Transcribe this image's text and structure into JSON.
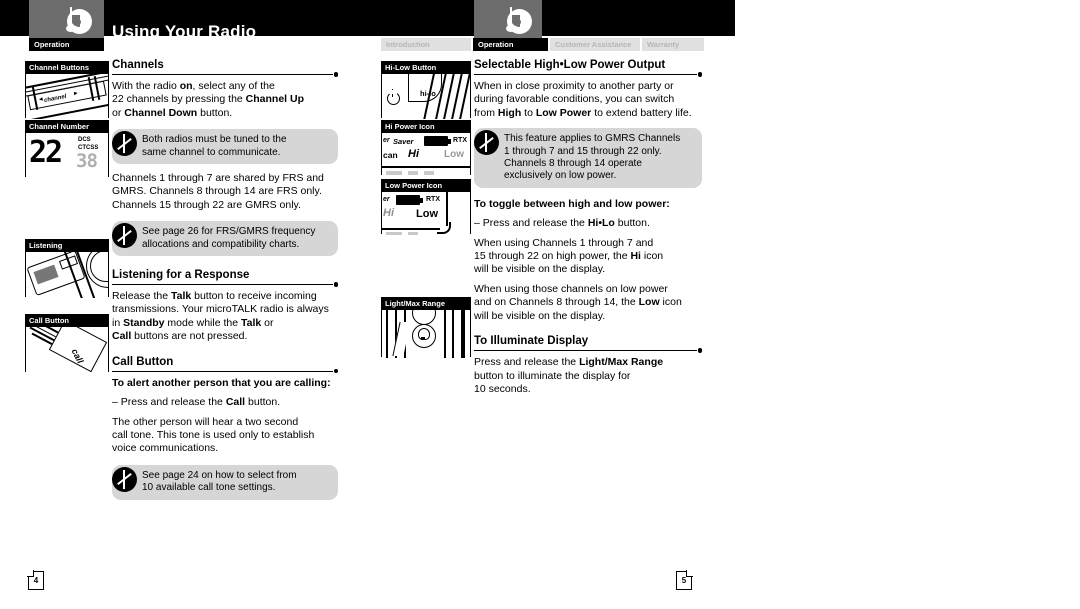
{
  "document": {
    "header_title": "Using Your Radio",
    "logo_name": "cobra-logo"
  },
  "tabs_left": [
    {
      "label": "Operation",
      "active": true
    }
  ],
  "tabs_right": [
    {
      "label": "Introduction",
      "active": false
    },
    {
      "label": "Operation",
      "active": true
    },
    {
      "label": "Customer Assistance",
      "active": false
    },
    {
      "label": "Warranty",
      "active": false
    }
  ],
  "left_page": {
    "page_number": "4",
    "figures": [
      {
        "caption": "Channel Buttons",
        "lcd": {
          "label": "channel",
          "left_arrow": "◄",
          "right_arrow": "►"
        }
      },
      {
        "caption": "Channel Number",
        "lcd": {
          "channel": "22",
          "sub": "38",
          "dcs": "DCS",
          "ctcss": "CTCSS"
        }
      },
      {
        "caption": "Listening"
      },
      {
        "caption": "Call Button",
        "lcd": {
          "label": "call"
        }
      }
    ],
    "sections": [
      {
        "heading": "Channels",
        "blocks": [
          {
            "type": "para",
            "runs": [
              {
                "t": "With the radio ",
                "b": false
              },
              {
                "t": "on",
                "b": true
              },
              {
                "t": ", select any of the\n22 channels by pressing the ",
                "b": false
              },
              {
                "t": "Channel Up",
                "b": true
              },
              {
                "t": "\nor ",
                "b": false
              },
              {
                "t": "Channel Down",
                "b": true
              },
              {
                "t": " button.",
                "b": false
              }
            ]
          },
          {
            "type": "callout",
            "text": "Both radios must be tuned to the\nsame channel to communicate."
          },
          {
            "type": "para",
            "runs": [
              {
                "t": "Channels 1 through 7 are shared by FRS and\nGMRS. Channels 8 through 14 are FRS only.\nChannels 15 through 22 are GMRS only.",
                "b": false
              }
            ]
          },
          {
            "type": "callout",
            "text": "See page 26 for FRS/GMRS frequency\nallocations and compatibility charts."
          }
        ]
      },
      {
        "heading": "Listening for a Response",
        "blocks": [
          {
            "type": "para",
            "runs": [
              {
                "t": "Release the ",
                "b": false
              },
              {
                "t": "Talk",
                "b": true
              },
              {
                "t": " button to receive incoming\ntransmissions. Your microTALK radio is always\nin ",
                "b": false
              },
              {
                "t": "Standby",
                "b": true
              },
              {
                "t": " mode while the ",
                "b": false
              },
              {
                "t": "Talk",
                "b": true
              },
              {
                "t": " or\n",
                "b": false
              },
              {
                "t": "Call",
                "b": true
              },
              {
                "t": " buttons are not pressed.",
                "b": false
              }
            ]
          }
        ]
      },
      {
        "heading": "Call Button",
        "blocks": [
          {
            "type": "subhead",
            "text": "To alert another person that you are calling:"
          },
          {
            "type": "para",
            "runs": [
              {
                "t": "– Press and release the ",
                "b": false
              },
              {
                "t": "Call",
                "b": true
              },
              {
                "t": " button.",
                "b": false
              }
            ]
          },
          {
            "type": "para",
            "runs": [
              {
                "t": "The other person will hear a two second\ncall tone. This tone is used only to establish\nvoice communications.",
                "b": false
              }
            ]
          },
          {
            "type": "callout",
            "text": "See page 24 on how to select from\n10 available call tone settings."
          }
        ]
      }
    ]
  },
  "right_page": {
    "page_number": "5",
    "figures": [
      {
        "caption": "Hi-Low Button",
        "lcd": {
          "label": "hi-lo",
          "power": "power-icon"
        }
      },
      {
        "caption": "Hi Power Icon",
        "lcd": {
          "saver": "Saver",
          "rtx": "RTX",
          "scan": "can",
          "hi": "Hi",
          "low": "Low",
          "prefix": "er"
        }
      },
      {
        "caption": "Low Power Icon",
        "lcd": {
          "saver": "er",
          "rtx": "RTX",
          "hi": "Hi",
          "low": "Low"
        }
      },
      {
        "caption": "Light/Max Range"
      }
    ],
    "sections": [
      {
        "heading": "Selectable High•Low Power Output",
        "blocks": [
          {
            "type": "para",
            "runs": [
              {
                "t": "When in close proximity to another party or\nduring favorable conditions, you can switch\nfrom ",
                "b": false
              },
              {
                "t": "High",
                "b": true
              },
              {
                "t": " to ",
                "b": false
              },
              {
                "t": "Low Power",
                "b": true
              },
              {
                "t": " to extend battery life.",
                "b": false
              }
            ]
          },
          {
            "type": "callout",
            "text": "This feature applies to GMRS Channels\n1 through 7 and 15 through 22 only.\nChannels 8 through 14 operate\nexclusively on low power."
          }
        ]
      },
      {
        "heading": "To toggle between high and low power:",
        "heading_style": "sub",
        "blocks": [
          {
            "type": "para",
            "runs": [
              {
                "t": "– Press and release the ",
                "b": false
              },
              {
                "t": "Hi•Lo",
                "b": true
              },
              {
                "t": " button.",
                "b": false
              }
            ]
          },
          {
            "type": "para",
            "runs": [
              {
                "t": "When using Channels 1 through 7 and\n15 through 22 on high power, the ",
                "b": false
              },
              {
                "t": "Hi",
                "b": true
              },
              {
                "t": " icon\nwill be visible on the display.",
                "b": false
              }
            ]
          },
          {
            "type": "para",
            "runs": [
              {
                "t": "When using those channels on low power\nand on Channels 8 through 14, the ",
                "b": false
              },
              {
                "t": "Low",
                "b": true
              },
              {
                "t": " icon\nwill be visible on the display.",
                "b": false
              }
            ]
          }
        ]
      },
      {
        "heading": "To Illuminate Display",
        "blocks": [
          {
            "type": "para",
            "runs": [
              {
                "t": "Press and release the ",
                "b": false
              },
              {
                "t": "Light/Max Range",
                "b": true
              },
              {
                "t": "\nbutton to illuminate the display for\n10 seconds.",
                "b": false
              }
            ]
          }
        ]
      }
    ]
  },
  "colors": {
    "header_black": "#000000",
    "logo_gray": "#6d6d6d",
    "callout_gray": "#d6d6d6",
    "tab_inactive": "#e0e0e0",
    "tab_inactive_text": "#b6b6b6"
  }
}
